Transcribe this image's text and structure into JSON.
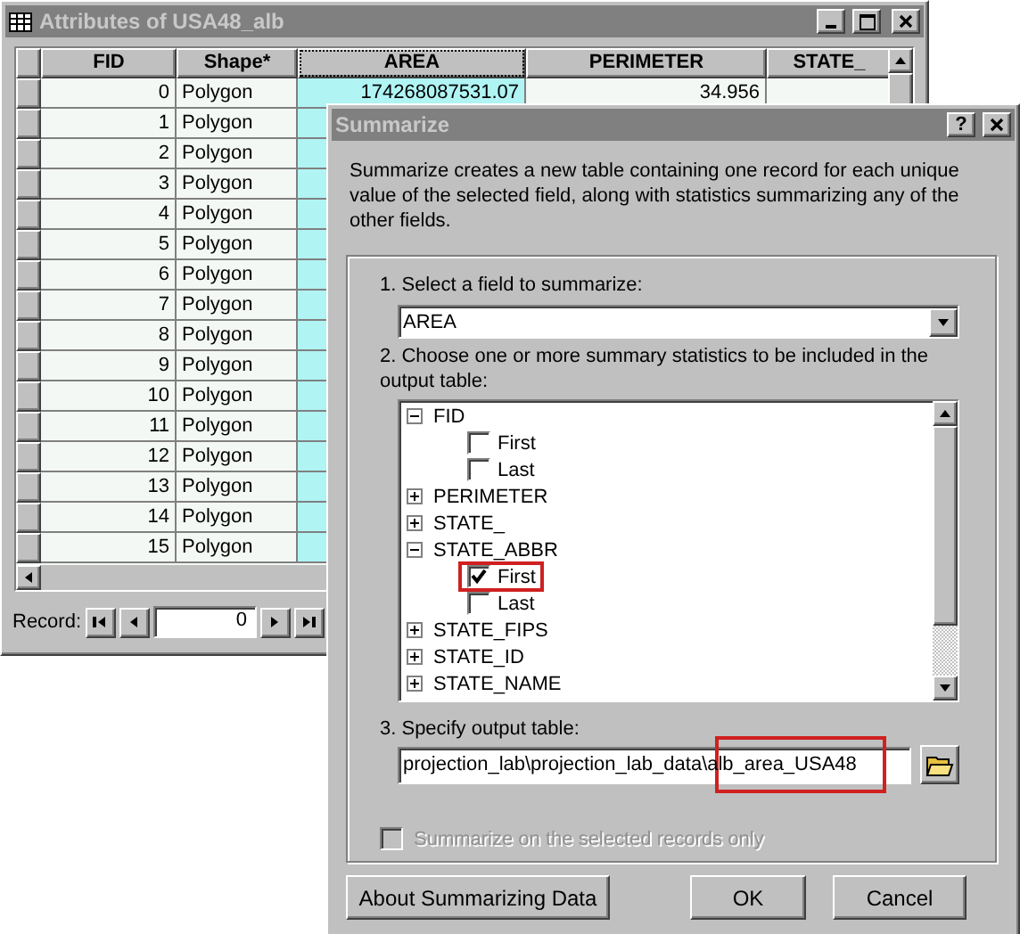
{
  "attributes_window": {
    "title": "Attributes of USA48_alb",
    "columns": [
      {
        "label": "FID",
        "selected": false
      },
      {
        "label": "Shape*",
        "selected": false
      },
      {
        "label": "AREA",
        "selected": true
      },
      {
        "label": "PERIMETER",
        "selected": false
      },
      {
        "label": "STATE_",
        "selected": false
      }
    ],
    "rows": [
      {
        "cells": [
          "0",
          "Polygon",
          "174268087531.07",
          "34.956",
          ""
        ]
      },
      {
        "cells": [
          "1",
          "Polygon"
        ]
      },
      {
        "cells": [
          "2",
          "Polygon"
        ]
      },
      {
        "cells": [
          "3",
          "Polygon"
        ]
      },
      {
        "cells": [
          "4",
          "Polygon"
        ]
      },
      {
        "cells": [
          "5",
          "Polygon"
        ]
      },
      {
        "cells": [
          "6",
          "Polygon"
        ]
      },
      {
        "cells": [
          "7",
          "Polygon"
        ]
      },
      {
        "cells": [
          "8",
          "Polygon"
        ]
      },
      {
        "cells": [
          "9",
          "Polygon"
        ]
      },
      {
        "cells": [
          "10",
          "Polygon"
        ]
      },
      {
        "cells": [
          "11",
          "Polygon"
        ]
      },
      {
        "cells": [
          "12",
          "Polygon"
        ]
      },
      {
        "cells": [
          "13",
          "Polygon"
        ]
      },
      {
        "cells": [
          "14",
          "Polygon"
        ]
      },
      {
        "cells": [
          "15",
          "Polygon"
        ]
      }
    ],
    "record_label": "Record:",
    "record_value": "0"
  },
  "summarize_dialog": {
    "title": "Summarize",
    "help_button": "?",
    "description": "Summarize creates a new table containing one record for each unique value of the selected field, along with statistics summarizing any of the other fields.",
    "step_1": "1.  Select a field to summarize:",
    "field_value": "AREA",
    "step_2": "2.  Choose one or more summary statistics to be included in the output table:",
    "tree": [
      {
        "label": "FID",
        "expanded": true,
        "children": [
          {
            "label": "First",
            "checked": false,
            "highlighted": false
          },
          {
            "label": "Last",
            "checked": false,
            "highlighted": false
          }
        ]
      },
      {
        "label": "PERIMETER",
        "expanded": false
      },
      {
        "label": "STATE_",
        "expanded": false
      },
      {
        "label": "STATE_ABBR",
        "expanded": true,
        "children": [
          {
            "label": "First",
            "checked": true,
            "highlighted": true
          },
          {
            "label": "Last",
            "checked": false,
            "highlighted": false
          }
        ]
      },
      {
        "label": "STATE_FIPS",
        "expanded": false
      },
      {
        "label": "STATE_ID",
        "expanded": false
      },
      {
        "label": "STATE_NAME",
        "expanded": false
      }
    ],
    "step_3": "3.  Specify output table:",
    "output_value": "projection_lab\\projection_lab_data\\alb_area_USA48",
    "output_highlighted": true,
    "selected_only": {
      "label": "Summarize on the selected records only",
      "checked": false,
      "disabled": true
    },
    "buttons": [
      {
        "label": "About Summarizing Data"
      },
      {
        "label": "OK"
      },
      {
        "label": "Cancel"
      }
    ]
  }
}
